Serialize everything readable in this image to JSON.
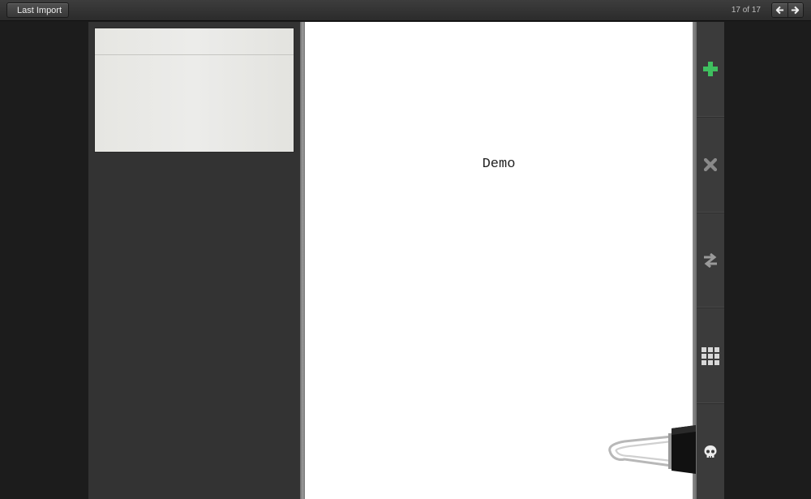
{
  "topbar": {
    "back_label": "Last Import",
    "page_counter": "17 of 17",
    "prev_icon": "arrow-left-icon",
    "next_icon": "arrow-right-icon"
  },
  "document": {
    "text": "Demo"
  },
  "toolbar": {
    "tools": [
      {
        "icon": "plus-icon",
        "color": "#3fbf5f"
      },
      {
        "icon": "close-icon",
        "color": "#8a8a8a"
      },
      {
        "icon": "swap-arrows-icon",
        "color": "#9a9a9a"
      },
      {
        "icon": "grid-icon",
        "color": "#d8d8d8"
      },
      {
        "icon": "skull-icon",
        "color": "#ececec"
      }
    ]
  },
  "colors": {
    "background": "#1c1c1c",
    "panel": "#333333",
    "toolbar": "#3b3b3b",
    "accent_green": "#3fbf5f"
  }
}
